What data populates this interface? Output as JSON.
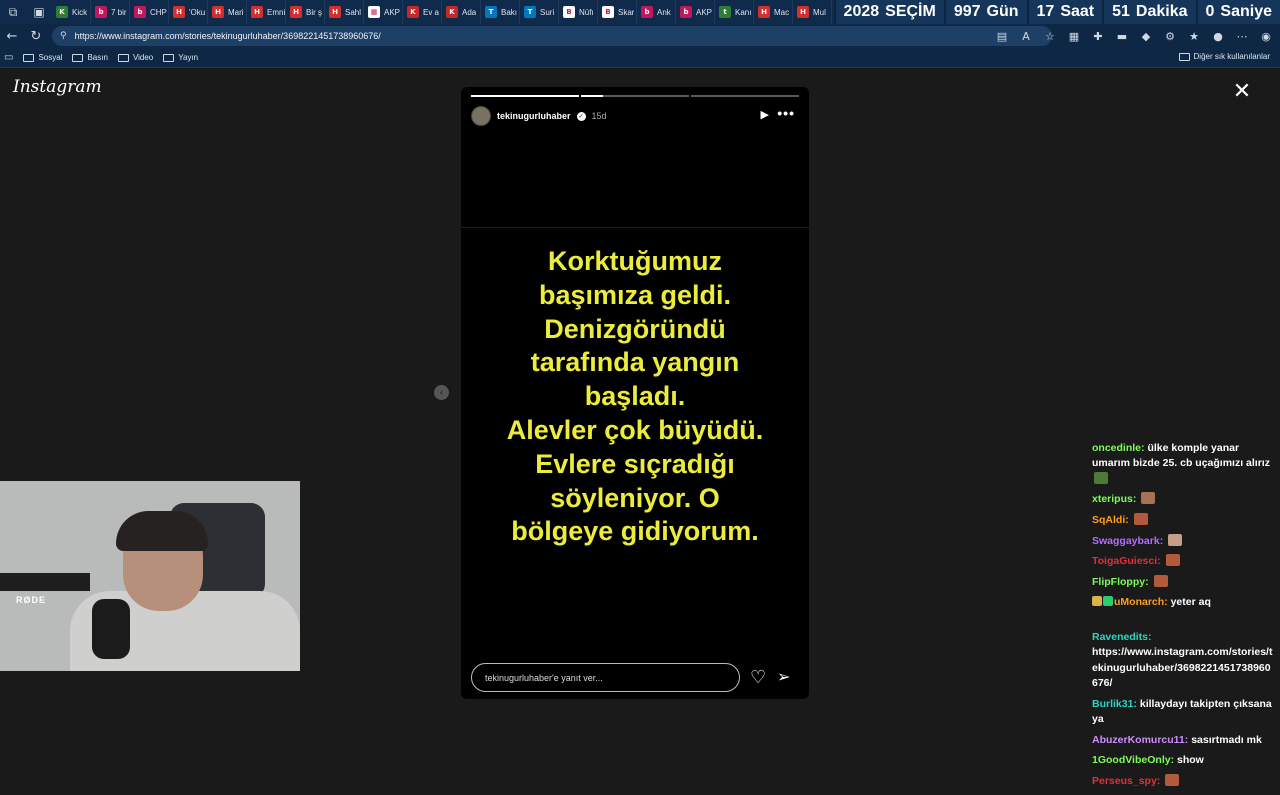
{
  "browser": {
    "tabs": [
      {
        "label": "Kick",
        "color": "#2e7d32",
        "glyph": "K"
      },
      {
        "label": "7 bir",
        "color": "#c2185b",
        "glyph": "b"
      },
      {
        "label": "CHP",
        "color": "#c2185b",
        "glyph": "b"
      },
      {
        "label": "'Oku",
        "color": "#d32f2f",
        "glyph": "H"
      },
      {
        "label": "Mari",
        "color": "#d32f2f",
        "glyph": "H"
      },
      {
        "label": "Emni",
        "color": "#d32f2f",
        "glyph": "H"
      },
      {
        "label": "Bir ş",
        "color": "#d32f2f",
        "glyph": "H"
      },
      {
        "label": "Sahl",
        "color": "#d32f2f",
        "glyph": "H"
      },
      {
        "label": "AKP",
        "color": "#ffffff",
        "glyph": "▦"
      },
      {
        "label": "Ev a",
        "color": "#c62828",
        "glyph": "K"
      },
      {
        "label": "Ada",
        "color": "#c62828",
        "glyph": "K"
      },
      {
        "label": "Bakı",
        "color": "#0277bd",
        "glyph": "T"
      },
      {
        "label": "Suri",
        "color": "#0277bd",
        "glyph": "T"
      },
      {
        "label": "Nüfı",
        "color": "#ffffff",
        "glyph": "B"
      },
      {
        "label": "Skar",
        "color": "#ffffff",
        "glyph": "B"
      },
      {
        "label": "Ank",
        "color": "#c2185b",
        "glyph": "b"
      },
      {
        "label": "AKP",
        "color": "#c2185b",
        "glyph": "b"
      },
      {
        "label": "Kanı",
        "color": "#2e7d32",
        "glyph": "t"
      },
      {
        "label": "Mac",
        "color": "#d32f2f",
        "glyph": "H"
      },
      {
        "label": "Mul",
        "color": "#d32f2f",
        "glyph": "H"
      }
    ],
    "countdown": {
      "year": "2028",
      "year_label": "SEÇİM",
      "days": "997",
      "days_label": "Gün",
      "hours": "17",
      "hours_label": "Saat",
      "minutes": "51",
      "minutes_label": "Dakika",
      "seconds": "0",
      "seconds_label": "Saniye"
    },
    "url": "https://www.instagram.com/stories/tekinugurluhaber/3698221451738960676/",
    "bookmarks": [
      "Sosyal",
      "Basın",
      "Video",
      "Yayın"
    ],
    "bookmarks_other": "Diğer sık kullanılanlar"
  },
  "instagram": {
    "logo": "Instagram",
    "story": {
      "username": "tekinugurluhaber",
      "time": "15d",
      "progress": [
        1.0,
        0.2,
        0.0
      ],
      "text_lines": [
        "Korktuğumuz",
        "başımıza geldi.",
        "Denizgöründü",
        "tarafında yangın",
        "başladı.",
        "Alevler çok büyüdü.",
        "Evlere sıçradığı",
        "söyleniyor. O",
        "bölgeye gidiyorum."
      ],
      "text_color": "#ecec3c",
      "reply_placeholder": "tekinugurluhaber'e yanıt ver..."
    }
  },
  "webcam": {
    "mic_brand": "RØDE"
  },
  "chat": {
    "messages": [
      {
        "user": "oncedinle",
        "color": "#7cfc5a",
        "text": "ülke komple yanar umarım bizde 25. cb uçağımızı alırız",
        "emote": "#4d7a36"
      },
      {
        "user": "xteripus",
        "color": "#7cfc5a",
        "text": "",
        "emote": "#a87054"
      },
      {
        "user": "SqAldi",
        "color": "#ff9f1c",
        "text": "",
        "emote": "#b45a3c"
      },
      {
        "user": "Swaggaybark",
        "color": "#b86bff",
        "text": "",
        "emote": "#c79e8a"
      },
      {
        "user": "ToigaGuiesci",
        "color": "#e0303c",
        "text": "",
        "emote": "#b45a3c"
      },
      {
        "user": "FlipFloppy",
        "color": "#7cfc5a",
        "text": "",
        "emote": "#b45a3c"
      },
      {
        "user": "uMonarch",
        "color": "#ff9f1c",
        "text": "yeter aq",
        "emote": "",
        "badges": [
          "#d9b24a",
          "#2ecc71"
        ]
      },
      {
        "user": "Ravenedits",
        "color": "#2dd4bf",
        "text": "https://www.instagram.com/stories/tekinugurluhaber/3698221451738960676/",
        "emote": "",
        "gap": true
      },
      {
        "user": "Burlik31",
        "color": "#2dd4bf",
        "text": "killaydayı takipten çıksana ya",
        "emote": ""
      },
      {
        "user": "AbuzerKomurcu11",
        "color": "#d08cff",
        "text": "sasırtmadı mk",
        "emote": ""
      },
      {
        "user": "1GoodVibeOnly",
        "color": "#7cfc5a",
        "text": "show",
        "emote": ""
      },
      {
        "user": "Perseus_spy",
        "color": "#e0303c",
        "text": "",
        "emote": "#b45a3c"
      }
    ]
  }
}
